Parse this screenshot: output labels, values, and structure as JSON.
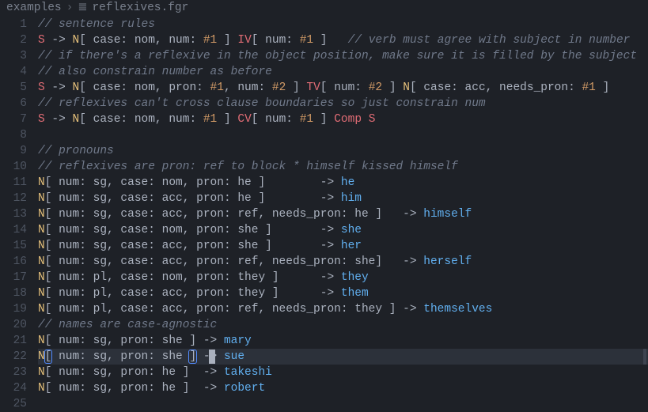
{
  "breadcrumb": {
    "folder": "examples",
    "file": "reflexives.fgr"
  },
  "active_line": 22,
  "cursor_col_ch": 27,
  "lines": [
    [
      {
        "c": "cm",
        "t": "// sentence rules"
      }
    ],
    [
      {
        "c": "kw",
        "t": "S"
      },
      {
        "c": "pn",
        "t": " -> "
      },
      {
        "c": "ty",
        "t": "N"
      },
      {
        "c": "pn",
        "t": "[ case: nom, num: "
      },
      {
        "c": "id",
        "t": "#1"
      },
      {
        "c": "pn",
        "t": " ] "
      },
      {
        "c": "kw",
        "t": "IV"
      },
      {
        "c": "pn",
        "t": "[ num: "
      },
      {
        "c": "id",
        "t": "#1"
      },
      {
        "c": "pn",
        "t": " ]   "
      },
      {
        "c": "cm",
        "t": "// verb must agree with subject in number"
      }
    ],
    [
      {
        "c": "cm",
        "t": "// if there's a reflexive in the object position, make sure it is filled by the subject"
      }
    ],
    [
      {
        "c": "cm",
        "t": "// also constrain number as before"
      }
    ],
    [
      {
        "c": "kw",
        "t": "S"
      },
      {
        "c": "pn",
        "t": " -> "
      },
      {
        "c": "ty",
        "t": "N"
      },
      {
        "c": "pn",
        "t": "[ case: nom, pron: "
      },
      {
        "c": "id",
        "t": "#1"
      },
      {
        "c": "pn",
        "t": ", num: "
      },
      {
        "c": "id",
        "t": "#2"
      },
      {
        "c": "pn",
        "t": " ] "
      },
      {
        "c": "kw",
        "t": "TV"
      },
      {
        "c": "pn",
        "t": "[ num: "
      },
      {
        "c": "id",
        "t": "#2"
      },
      {
        "c": "pn",
        "t": " ] "
      },
      {
        "c": "ty",
        "t": "N"
      },
      {
        "c": "pn",
        "t": "[ case: acc, needs_pron: "
      },
      {
        "c": "id",
        "t": "#1"
      },
      {
        "c": "pn",
        "t": " ]"
      }
    ],
    [
      {
        "c": "cm",
        "t": "// reflexives can't cross clause boundaries so just constrain num"
      }
    ],
    [
      {
        "c": "kw",
        "t": "S"
      },
      {
        "c": "pn",
        "t": " -> "
      },
      {
        "c": "ty",
        "t": "N"
      },
      {
        "c": "pn",
        "t": "[ case: nom, num: "
      },
      {
        "c": "id",
        "t": "#1"
      },
      {
        "c": "pn",
        "t": " ] "
      },
      {
        "c": "kw",
        "t": "CV"
      },
      {
        "c": "pn",
        "t": "[ num: "
      },
      {
        "c": "id",
        "t": "#1"
      },
      {
        "c": "pn",
        "t": " ] "
      },
      {
        "c": "kw",
        "t": "Comp"
      },
      {
        "c": "pn",
        "t": " "
      },
      {
        "c": "kw",
        "t": "S"
      }
    ],
    [
      {
        "c": "pn",
        "t": ""
      }
    ],
    [
      {
        "c": "cm",
        "t": "// pronouns"
      }
    ],
    [
      {
        "c": "cm",
        "t": "// reflexives are pron: ref to block * himself kissed himself"
      }
    ],
    [
      {
        "c": "ty",
        "t": "N"
      },
      {
        "c": "pn",
        "t": "[ num: sg, case: nom, pron: he ]        -> "
      },
      {
        "c": "lt",
        "t": "he"
      }
    ],
    [
      {
        "c": "ty",
        "t": "N"
      },
      {
        "c": "pn",
        "t": "[ num: sg, case: acc, pron: he ]        -> "
      },
      {
        "c": "lt",
        "t": "him"
      }
    ],
    [
      {
        "c": "ty",
        "t": "N"
      },
      {
        "c": "pn",
        "t": "[ num: sg, case: acc, pron: ref, needs_pron: he ]   -> "
      },
      {
        "c": "lt",
        "t": "himself"
      }
    ],
    [
      {
        "c": "ty",
        "t": "N"
      },
      {
        "c": "pn",
        "t": "[ num: sg, case: nom, pron: she ]       -> "
      },
      {
        "c": "lt",
        "t": "she"
      }
    ],
    [
      {
        "c": "ty",
        "t": "N"
      },
      {
        "c": "pn",
        "t": "[ num: sg, case: acc, pron: she ]       -> "
      },
      {
        "c": "lt",
        "t": "her"
      }
    ],
    [
      {
        "c": "ty",
        "t": "N"
      },
      {
        "c": "pn",
        "t": "[ num: sg, case: acc, pron: ref, needs_pron: she]   -> "
      },
      {
        "c": "lt",
        "t": "herself"
      }
    ],
    [
      {
        "c": "ty",
        "t": "N"
      },
      {
        "c": "pn",
        "t": "[ num: pl, case: nom, pron: they ]      -> "
      },
      {
        "c": "lt",
        "t": "they"
      }
    ],
    [
      {
        "c": "ty",
        "t": "N"
      },
      {
        "c": "pn",
        "t": "[ num: pl, case: acc, pron: they ]      -> "
      },
      {
        "c": "lt",
        "t": "them"
      }
    ],
    [
      {
        "c": "ty",
        "t": "N"
      },
      {
        "c": "pn",
        "t": "[ num: pl, case: acc, pron: ref, needs_pron: they ] -> "
      },
      {
        "c": "lt",
        "t": "themselves"
      }
    ],
    [
      {
        "c": "cm",
        "t": "// names are case-agnostic"
      }
    ],
    [
      {
        "c": "ty",
        "t": "N"
      },
      {
        "c": "pn",
        "t": "[ num: sg, pron: she ] -> "
      },
      {
        "c": "lt",
        "t": "mary"
      }
    ],
    [
      {
        "c": "ty",
        "t": "N"
      },
      {
        "c": "pn hlbr",
        "t": "["
      },
      {
        "c": "pn",
        "t": " num: sg, pron: she "
      },
      {
        "c": "pn hlbr",
        "t": "]"
      },
      {
        "c": "pn",
        "t": " -> "
      },
      {
        "c": "lt",
        "t": "sue"
      }
    ],
    [
      {
        "c": "ty",
        "t": "N"
      },
      {
        "c": "pn",
        "t": "[ num: sg, pron: he ]  -> "
      },
      {
        "c": "lt",
        "t": "takeshi"
      }
    ],
    [
      {
        "c": "ty",
        "t": "N"
      },
      {
        "c": "pn",
        "t": "[ num: sg, pron: he ]  -> "
      },
      {
        "c": "lt",
        "t": "robert"
      }
    ],
    [
      {
        "c": "pn",
        "t": ""
      }
    ]
  ]
}
